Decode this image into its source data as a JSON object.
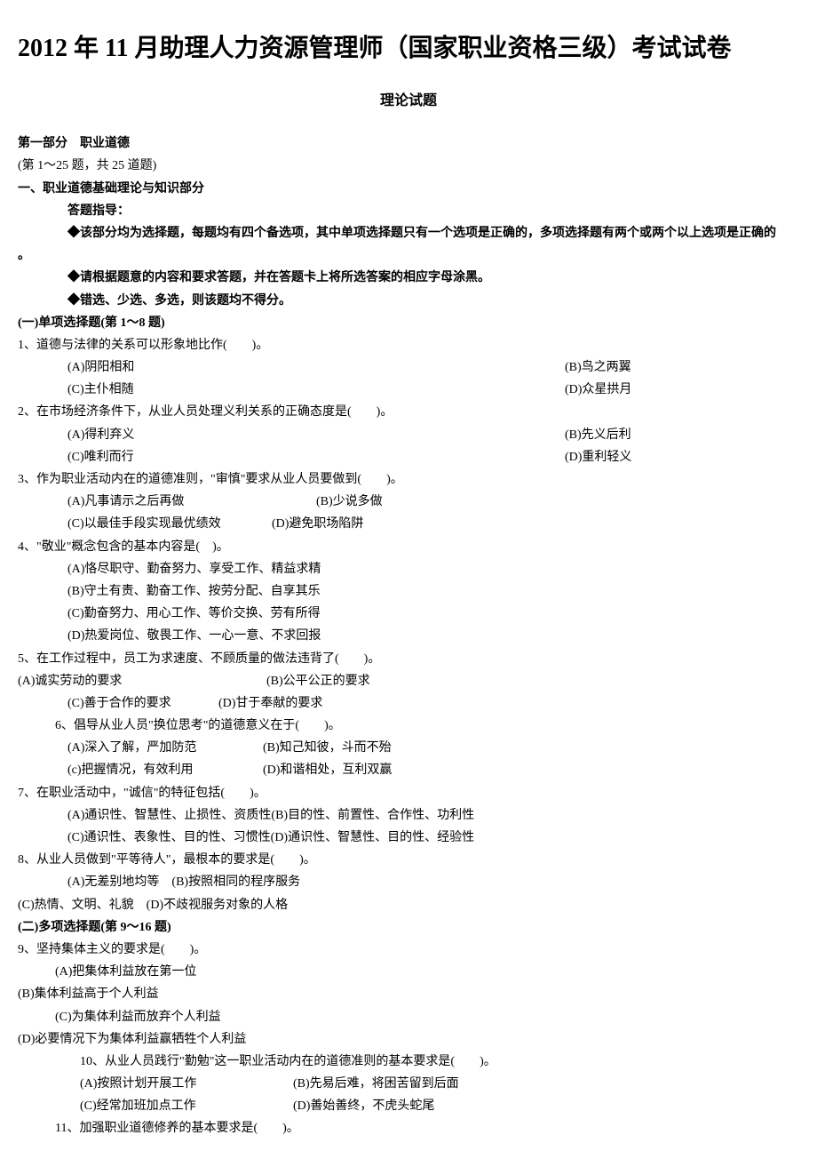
{
  "title": "2012 年 11 月助理人力资源管理师（国家职业资格三级）考试试卷",
  "subtitle": "理论试题",
  "part1_label": "第一部分　职业道德",
  "part1_range": "(第 1～25 题，共 25 道题)",
  "section1_title": "一、职业道德基础理论与知识部分",
  "guide_label": "答题指导：",
  "guide_1": "◆该部分均为选择题，每题均有四个备选项，其中单项选择题只有一个选项是正确的，多项选择题有两个或两个以上选项是正确的",
  "guide_dot": "。",
  "guide_2": "◆请根据题意的内容和要求答题，并在答题卡上将所选答案的相应字母涂黑。",
  "guide_3": "◆错选、少选、多选，则该题均不得分。",
  "sub1_title": "(一)单项选择题(第 1～8 题)",
  "q1": "1、道德与法律的关系可以形象地比作(　　)。",
  "q1a": "(A)阴阳相和",
  "q1b": "(B)鸟之两翼",
  "q1c": "(C)主仆相随",
  "q1d": "(D)众星拱月",
  "q2": "2、在市场经济条件下，从业人员处理义利关系的正确态度是(　　)。",
  "q2a": "(A)得利弃义",
  "q2b": "(B)先义后利",
  "q2c": "(C)唯利而行",
  "q2d": "(D)重利轻义",
  "q3": "3、作为职业活动内在的道德准则，\"审慎\"要求从业人员要做到(　　)。",
  "q3a": "(A)凡事请示之后再做",
  "q3b": "(B)少说多做",
  "q3c": "(C)以最佳手段实现最优绩效",
  "q3d": "(D)避免职场陷阱",
  "q4": "4、\"敬业\"概念包含的基本内容是(　)。",
  "q4a": "(A)恪尽职守、勤奋努力、享受工作、精益求精",
  "q4b": "(B)守土有责、勤奋工作、按劳分配、自享其乐",
  "q4c": "(C)勤奋努力、用心工作、等价交换、劳有所得",
  "q4d": "(D)热爱岗位、敬畏工作、一心一意、不求回报",
  "q5": "5、在工作过程中，员工为求速度、不顾质量的做法违背了(　　)。",
  "q5a": "(A)诚实劳动的要求",
  "q5b": "(B)公平公正的要求",
  "q5c": "(C)善于合作的要求",
  "q5d": "(D)甘于奉献的要求",
  "q6": "6、倡导从业人员\"换位思考\"的道德意义在于(　　)。",
  "q6a": "(A)深入了解，严加防范",
  "q6b": "(B)知己知彼，斗而不殆",
  "q6c": "(c)把握情况，有效利用",
  "q6d": "(D)和谐相处，互利双赢",
  "q7": "7、在职业活动中，\"诚信\"的特征包括(　　)。",
  "q7a": "(A)通识性、智慧性、止损性、资质性(B)目的性、前置性、合作性、功利性",
  "q7c": "(C)通识性、表象性、目的性、习惯性(D)通识性、智慧性、目的性、经验性",
  "q8": "8、从业人员做到\"平等待人\"，最根本的要求是(　　)。",
  "q8a": "(A)无差别地均等　(B)按照相同的程序服务",
  "q8c": "(C)热情、文明、礼貌　(D)不歧视服务对象的人格",
  "sub2_title": " (二)多项选择题(第 9～16 题)",
  "q9": "9、坚持集体主义的要求是(　　)。",
  "q9a": "(A)把集体利益放在第一位",
  "q9b": "(B)集体利益高于个人利益",
  "q9c": "(C)为集体利益而放弃个人利益",
  "q9d": "(D)必要情况下为集体利益赢牺牲个人利益",
  "q10": "10、从业人员践行\"勤勉\"这一职业活动内在的道德准则的基本要求是(　　)。",
  "q10a": "(A)按照计划开展工作",
  "q10b": "(B)先易后难，将困苦留到后面",
  "q10c": "(C)经常加班加点工作",
  "q10d": "(D)善始善终，不虎头蛇尾",
  "q11": "11、加强职业道德修养的基本要求是(　　)。"
}
